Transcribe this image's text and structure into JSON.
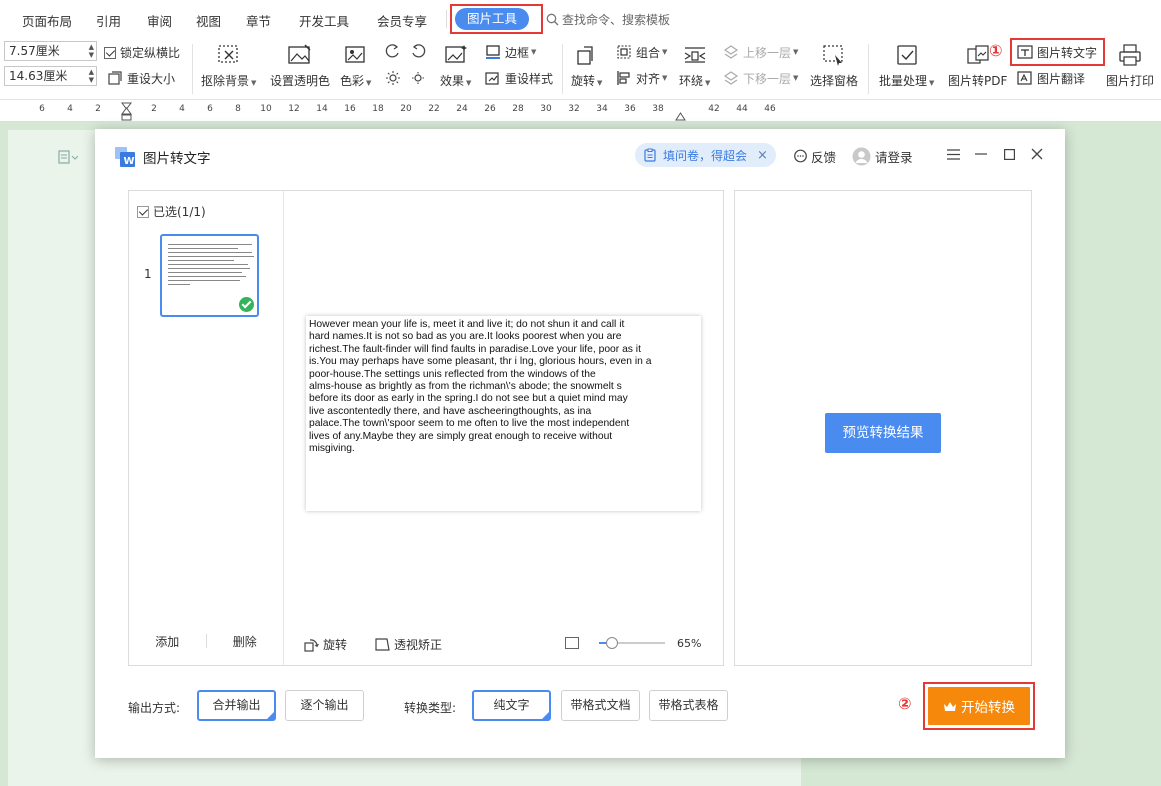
{
  "menu": {
    "items": [
      "页面布局",
      "引用",
      "审阅",
      "视图",
      "章节",
      "开发工具",
      "会员专享"
    ],
    "active_tab": "图片工具",
    "search_placeholder": "查找命令、搜索模板"
  },
  "ribbon": {
    "width_value": "7.57厘米",
    "height_value": "14.63厘米",
    "lock_ratio": "锁定纵横比",
    "reset_size": "重设大小",
    "remove_bg": "抠除背景",
    "set_transparent": "设置透明色",
    "color": "色彩",
    "effects": "效果",
    "border": "边框",
    "reset_style": "重设样式",
    "rotate": "旋转",
    "group": "组合",
    "align": "对齐",
    "wrap": "环绕",
    "bring_forward": "上移一层",
    "send_backward": "下移一层",
    "selection_pane": "选择窗格",
    "batch": "批量处理",
    "to_pdf": "图片转PDF",
    "to_text": "图片转文字",
    "translate": "图片翻译",
    "print": "图片打印"
  },
  "ruler_ticks": [
    "6",
    "4",
    "2",
    "2",
    "4",
    "6",
    "8",
    "10",
    "12",
    "14",
    "16",
    "18",
    "20",
    "22",
    "24",
    "26",
    "28",
    "30",
    "32",
    "34",
    "36",
    "38",
    "42",
    "44",
    "46"
  ],
  "annotations": {
    "step1": "①",
    "step2": "②"
  },
  "dialog": {
    "title": "图片转文字",
    "survey": "填问卷，得超会",
    "survey_close": "×",
    "feedback": "反馈",
    "login": "请登录",
    "selected": "已选(1/1)",
    "page_num": "1",
    "add": "添加",
    "delete": "删除",
    "rotate": "旋转",
    "perspective": "透视矫正",
    "zoom": "65%",
    "preview_result": "预览转换结果",
    "output_label": "输出方式:",
    "output_merge": "合并输出",
    "output_each": "逐个输出",
    "type_label": "转换类型:",
    "type_plain": "纯文字",
    "type_doc": "带格式文档",
    "type_table": "带格式表格",
    "start": "开始转换"
  },
  "preview_lines": [
    "However mean your life is,   meet it and live it;   do not shun it and call it",
    "hard names.It is not so bad as you are.It looks poorest when you are",
    "richest.The fault-finder will find faults in paradise.Love your life,   poor as it",
    "is.You may perhaps have some pleasant,   thr i lng,   glorious hours,   even in a",
    "poor-house.The settings unis reflected from the windows of the",
    "alms-house as brightly as from the richman\\'s abode;   the snowmelt s",
    "before its door as early in the spring.I do not see but a quiet mind may",
    "live ascontentedly there,   and have ascheeringthoughts,   as ina",
    "palace.The town\\'spoor seem to me often to live the most independent",
    "lives of any.Maybe they are simply great enough to receive without",
    "misgiving."
  ],
  "colors": {
    "accent": "#4a8bf0",
    "start": "#f6890c",
    "highlight": "#e53935",
    "doc_bg": "#d5e8d4"
  }
}
